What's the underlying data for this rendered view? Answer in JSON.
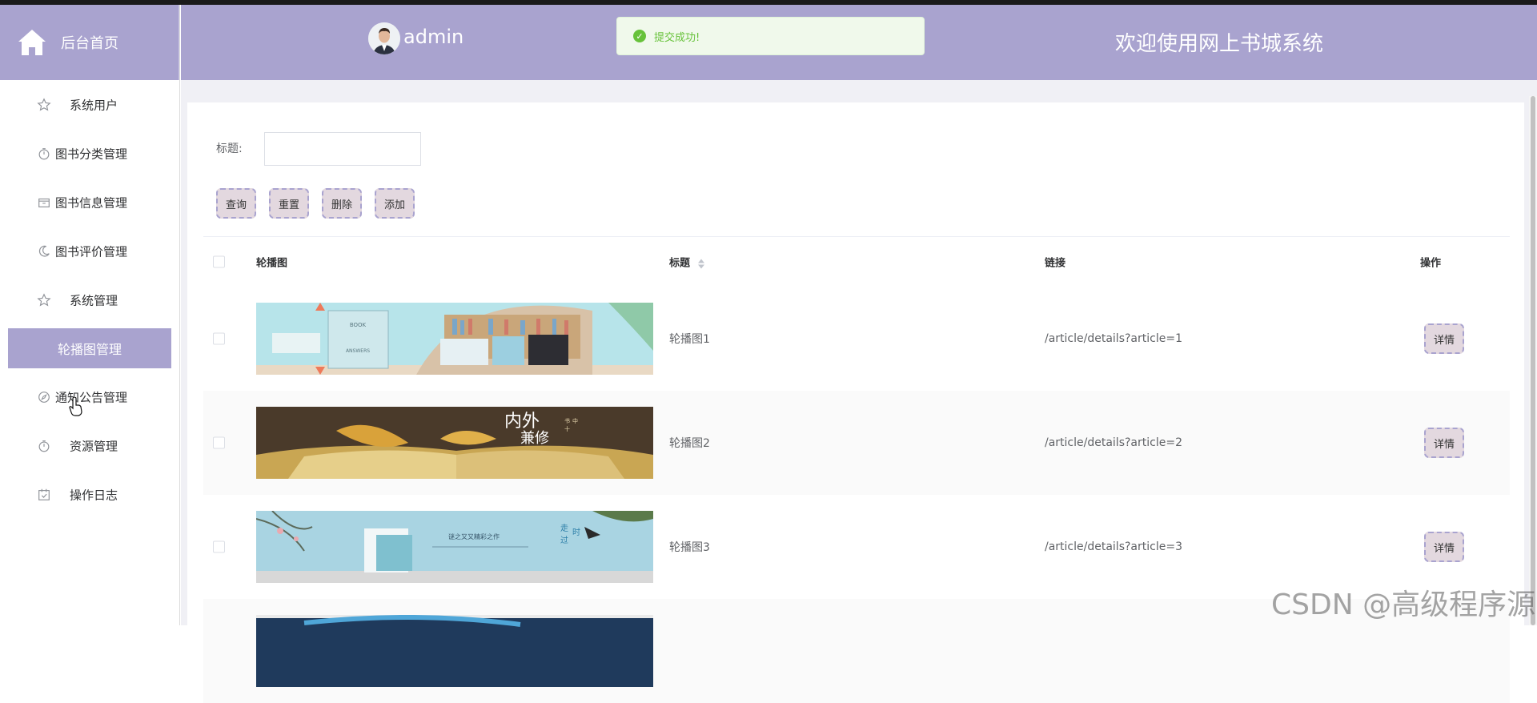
{
  "brand": {
    "label": "后台首页",
    "icon": "home-icon"
  },
  "sidebar": {
    "items": [
      {
        "label": "系统用户",
        "icon": "star-icon"
      },
      {
        "label": "图书分类管理",
        "icon": "timer-icon"
      },
      {
        "label": "图书信息管理",
        "icon": "box-icon"
      },
      {
        "label": "图书评价管理",
        "icon": "moon-icon"
      },
      {
        "label": "系统管理",
        "icon": "star-icon"
      },
      {
        "label": "轮播图管理",
        "icon": "",
        "active": true
      },
      {
        "label": "通知公告管理",
        "icon": "compass-icon"
      },
      {
        "label": "资源管理",
        "icon": "timer-icon"
      },
      {
        "label": "操作日志",
        "icon": "calendar-check-icon"
      }
    ]
  },
  "header": {
    "username": "admin",
    "toast": "提交成功!",
    "welcome": "欢迎使用网上书城系统",
    "accent": "#a9a3cf"
  },
  "search": {
    "label": "标题:",
    "value": "",
    "placeholder": ""
  },
  "actions": {
    "query": "查询",
    "reset": "重置",
    "delete": "删除",
    "add": "添加"
  },
  "table": {
    "columns": [
      "轮播图",
      "标题",
      "链接",
      "操作"
    ],
    "rows": [
      {
        "title": "轮播图1",
        "link": "/article/details?article=1",
        "action": "详情"
      },
      {
        "title": "轮播图2",
        "link": "/article/details?article=2",
        "action": "详情"
      },
      {
        "title": "轮播图3",
        "link": "/article/details?article=3",
        "action": "详情"
      }
    ]
  },
  "watermark": "CSDN @高级程序源"
}
